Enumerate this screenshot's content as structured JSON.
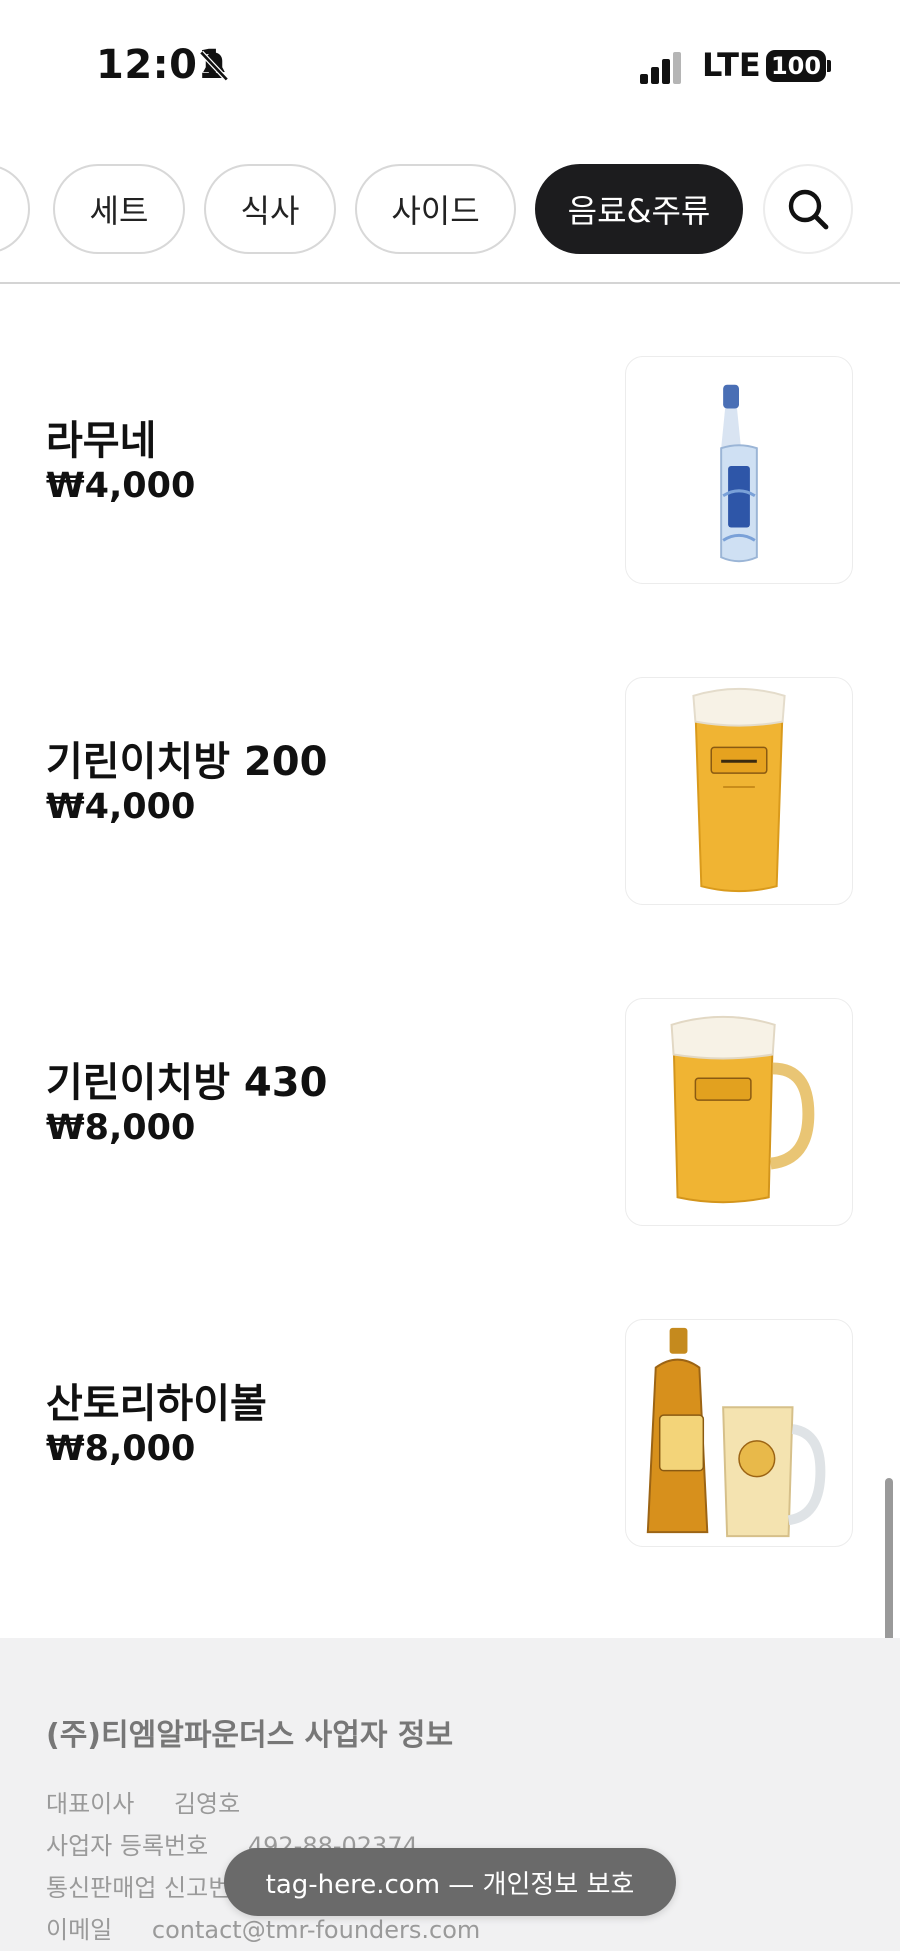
{
  "status_bar": {
    "time": "12:01",
    "network": "LTE",
    "battery": "100"
  },
  "tabs": [
    {
      "label": "세트",
      "active": false
    },
    {
      "label": "식사",
      "active": false
    },
    {
      "label": "사이드",
      "active": false
    },
    {
      "label": "음료&주류",
      "active": true
    }
  ],
  "menu_items": [
    {
      "name": "라무네",
      "price": "₩4,000",
      "image": "ramune-bottle"
    },
    {
      "name": "기린이치방 200",
      "price": "₩4,000",
      "image": "beer-glass"
    },
    {
      "name": "기린이치방 430",
      "price": "₩8,000",
      "image": "beer-mug"
    },
    {
      "name": "산토리하이볼",
      "price": "₩8,000",
      "image": "whisky-highball"
    }
  ],
  "footer": {
    "title": "(주)티엠알파운더스 사업자 정보",
    "ceo_label": "대표이사",
    "ceo_value": "김영호",
    "biz_no_label": "사업자 등록번호",
    "biz_no_value": "492-88-02374",
    "ecommerce_label": "통신판매업 신고번호",
    "email_label": "이메일",
    "email_value": "contact@tmr-founders.com"
  },
  "toast": {
    "text": "tag-here.com — 개인정보 보호"
  },
  "colors": {
    "active_tab_bg": "#1c1c1e",
    "footer_bg": "#f1f1f2",
    "toast_bg": "#6a6a6a"
  }
}
